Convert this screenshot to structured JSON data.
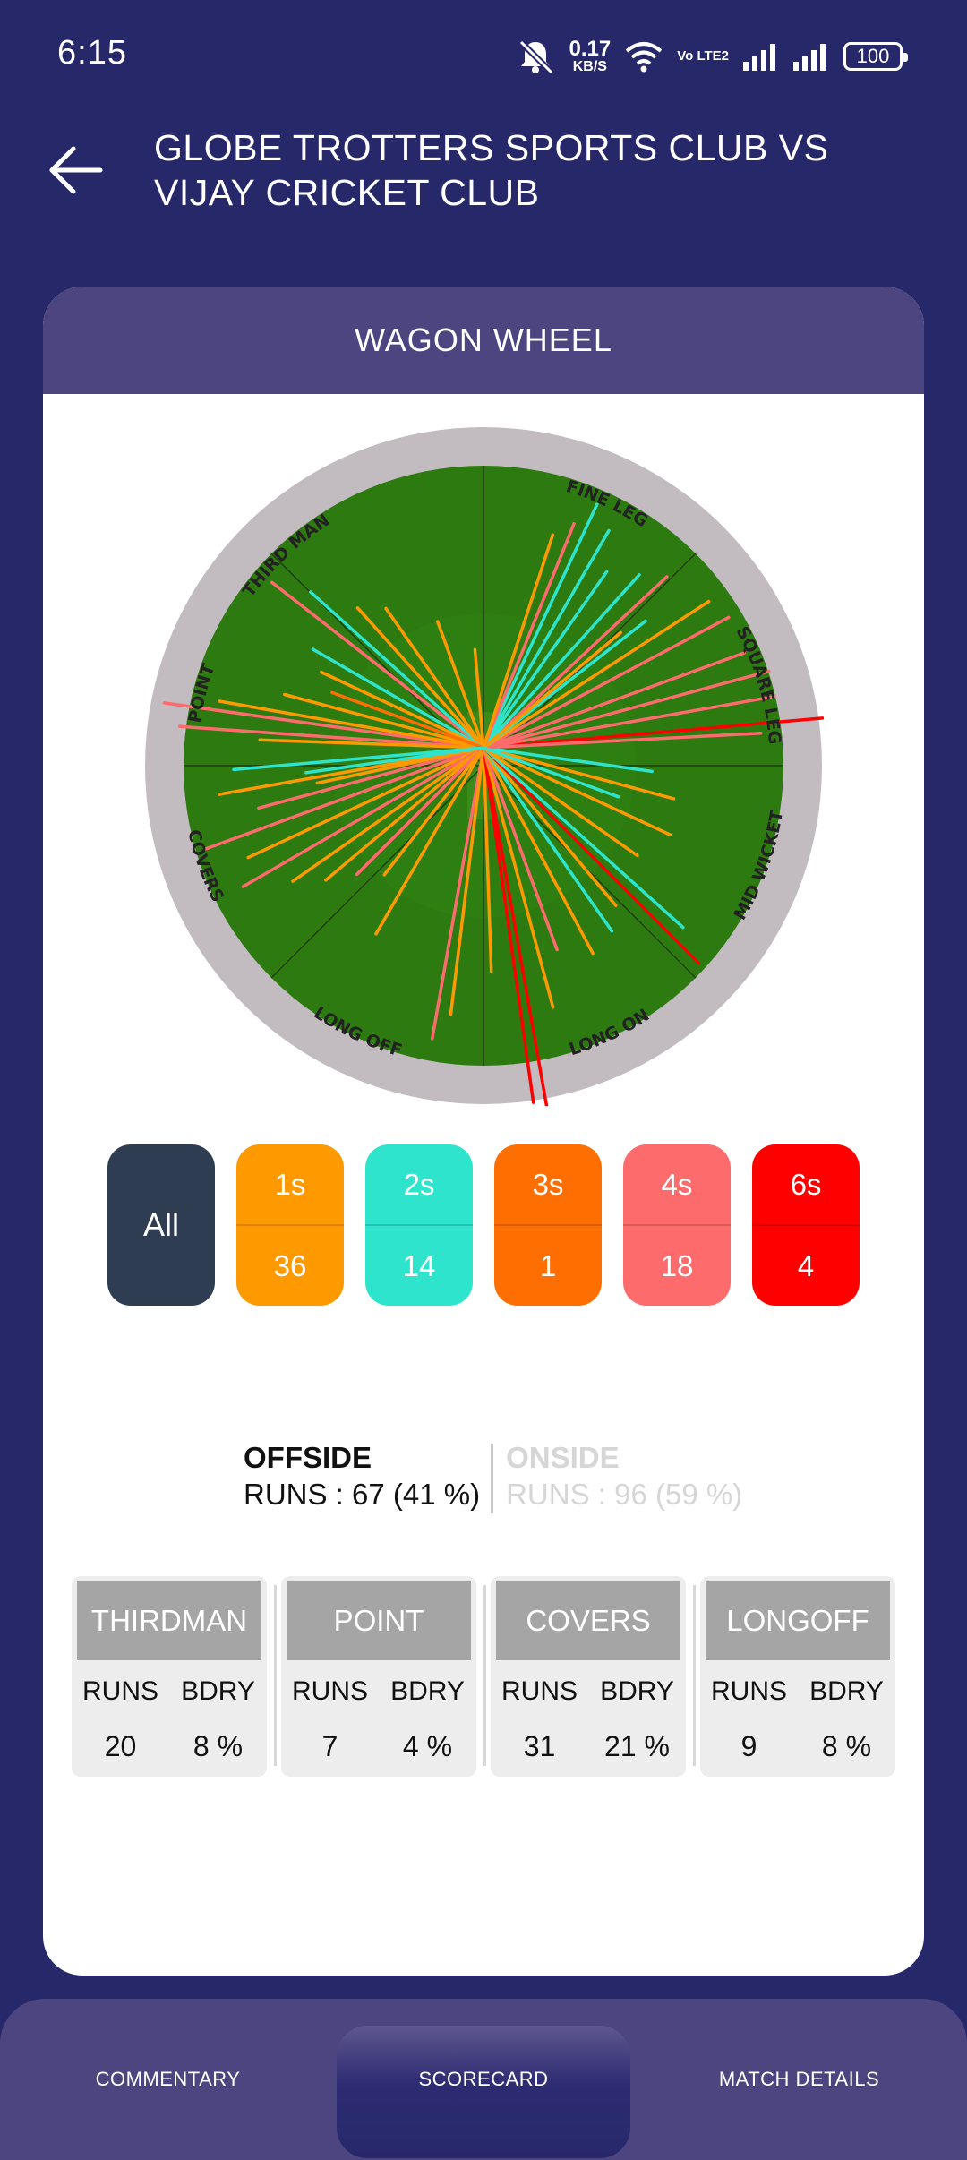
{
  "status_bar": {
    "time": "6:15",
    "net_speed": "0.17",
    "net_unit": "KB/S",
    "volte": "Vo LTE2",
    "battery": "100",
    "icons": [
      "mute-icon",
      "wifi-icon",
      "signal-icon",
      "signal-icon",
      "battery-icon"
    ]
  },
  "header": {
    "title": "GLOBE TROTTERS SPORTS CLUB VS VIJAY CRICKET CLUB",
    "back_icon": "arrow-left-icon"
  },
  "card": {
    "title": "WAGON WHEEL",
    "field_labels": {
      "third_man": "THIRD MAN",
      "fine_leg": "FINE LEG",
      "square_leg": "SQUARE LEG",
      "mid_wicket": "MID WICKET",
      "long_on": "LONG ON",
      "long_off": "LONG OFF",
      "covers": "COVERS",
      "point": "POINT"
    },
    "filters": [
      {
        "label": "All",
        "color": "#2e3d51"
      },
      {
        "label": "1s",
        "count": "36",
        "color": "#fe9900"
      },
      {
        "label": "2s",
        "count": "14",
        "color": "#2ee4cc"
      },
      {
        "label": "3s",
        "count": "1",
        "color": "#ff6e00"
      },
      {
        "label": "4s",
        "count": "18",
        "color": "#fe6b6c"
      },
      {
        "label": "6s",
        "count": "4",
        "color": "#ff0000"
      }
    ],
    "offside": {
      "name": "OFFSIDE",
      "runs": "RUNS : 67 (41 %)"
    },
    "onside": {
      "name": "ONSIDE",
      "runs": "RUNS : 96 (59 %)"
    },
    "zone_headers": {
      "runs": "RUNS",
      "bdry": "BDRY"
    },
    "zones": [
      {
        "name": "THIRDMAN",
        "runs": "20",
        "bdry": "8 %"
      },
      {
        "name": "POINT",
        "runs": "7",
        "bdry": "4 %"
      },
      {
        "name": "COVERS",
        "runs": "31",
        "bdry": "21 %"
      },
      {
        "name": "LONGOFF",
        "runs": "9",
        "bdry": "8 %"
      }
    ]
  },
  "bottom_nav": {
    "commentary": "COMMENTARY",
    "scorecard": "SCORECARD",
    "match_details": "MATCH DETAILS",
    "active": "SCORECARD"
  }
}
